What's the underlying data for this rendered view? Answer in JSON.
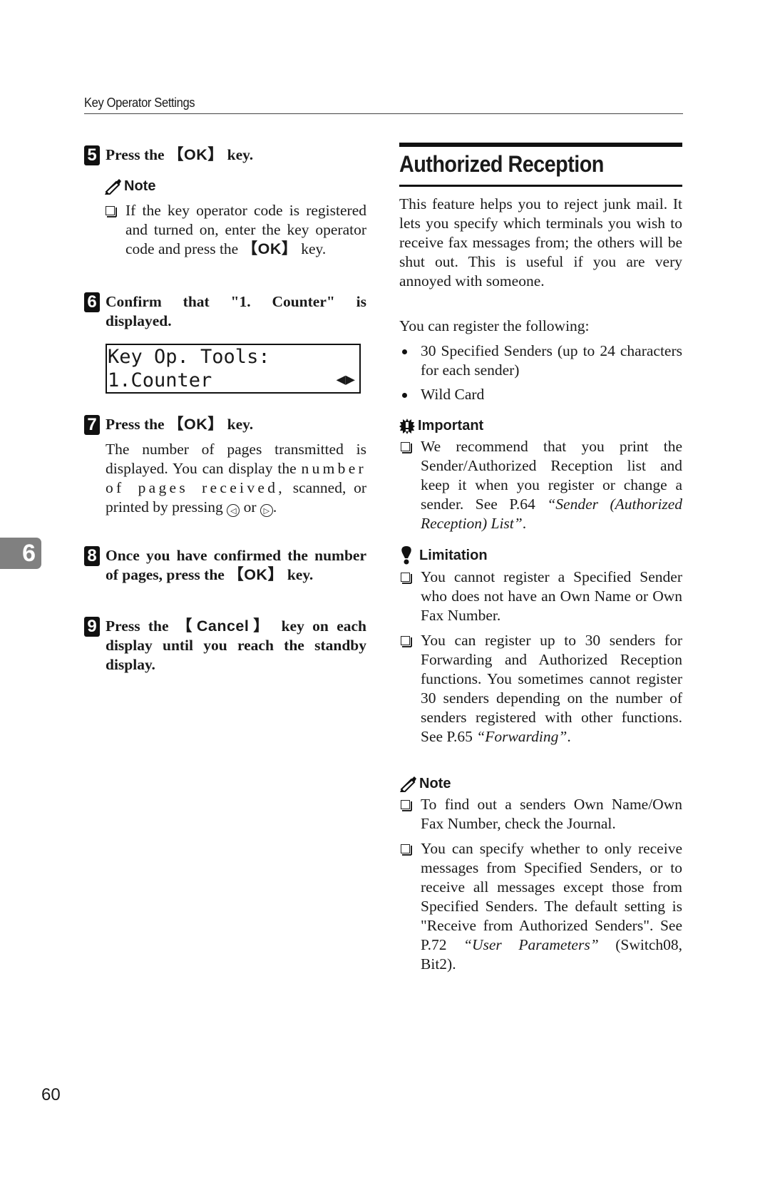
{
  "header": {
    "running_title": "Key Operator Settings"
  },
  "chapter_tab": {
    "number": "6"
  },
  "page_number": "60",
  "left_column": {
    "step5": {
      "number": "5",
      "pre": "Press the ",
      "key": "【OK】",
      "post": " key.",
      "note": {
        "label": "Note",
        "item_pre": "If the key operator code is registered and turned on, enter the key operator code and press the ",
        "item_key": "【OK】",
        "item_post": " key."
      }
    },
    "step6": {
      "number": "6",
      "text": "Confirm that \"1. Counter\" is displayed.",
      "lcd": {
        "line1": "Key Op. Tools:",
        "line2": "1.Counter",
        "arrows": "◀▶"
      }
    },
    "step7": {
      "number": "7",
      "pre": "Press the ",
      "key": "【OK】",
      "post": " key.",
      "body_a": "The number of pages transmitted is displayed. You can display the ",
      "body_b": "number of pages received,",
      "body_c": " scanned, or printed by pressing ",
      "left_key": "◁",
      "or": " or ",
      "right_key": "▷",
      "end": "."
    },
    "step8": {
      "number": "8",
      "pre": "Once you have confirmed the number of pages, press the ",
      "key": "【OK】",
      "post": " key."
    },
    "step9": {
      "number": "9",
      "pre": "Press the ",
      "key": "【Cancel】",
      "post": " key on each display until you reach the standby display."
    }
  },
  "right_column": {
    "section_title": "Authorized Reception",
    "intro": "This feature helps you to reject junk mail. It lets you specify which terminals you wish to receive fax messages from; the others will be shut out. This is useful if you are very annoyed with someone.",
    "register_lead": "You can register the following:",
    "register_items": [
      "30 Specified Senders (up to 24 characters for each sender)",
      "Wild Card"
    ],
    "important": {
      "label": "Important",
      "item_pre": "We recommend that you print the Sender/Authorized Reception list and keep it when you register or change a sender. See P.64 ",
      "item_ref": "“Sender (Authorized Reception) List”",
      "item_post": "."
    },
    "limitation": {
      "label": "Limitation",
      "item1": "You cannot register a Specified Sender who does not have an Own Name or Own Fax Number.",
      "item2_pre": "You can register up to 30 senders for Forwarding and Authorized Reception functions. You sometimes cannot register 30 senders depending on the number of senders registered with other functions. See P.65 ",
      "item2_ref": "“Forwarding”",
      "item2_post": "."
    },
    "note": {
      "label": "Note",
      "item1": "To find out a senders Own Name/Own Fax Number, check the Journal.",
      "item2_pre": "You can specify whether to only receive messages from Specified Senders, or to receive all messages except those from Specified Senders. The default setting is \"Receive from Authorized Senders\". See P.72 ",
      "item2_ref": "“User Parameters”",
      "item2_post": " (Switch08, Bit2)."
    }
  }
}
